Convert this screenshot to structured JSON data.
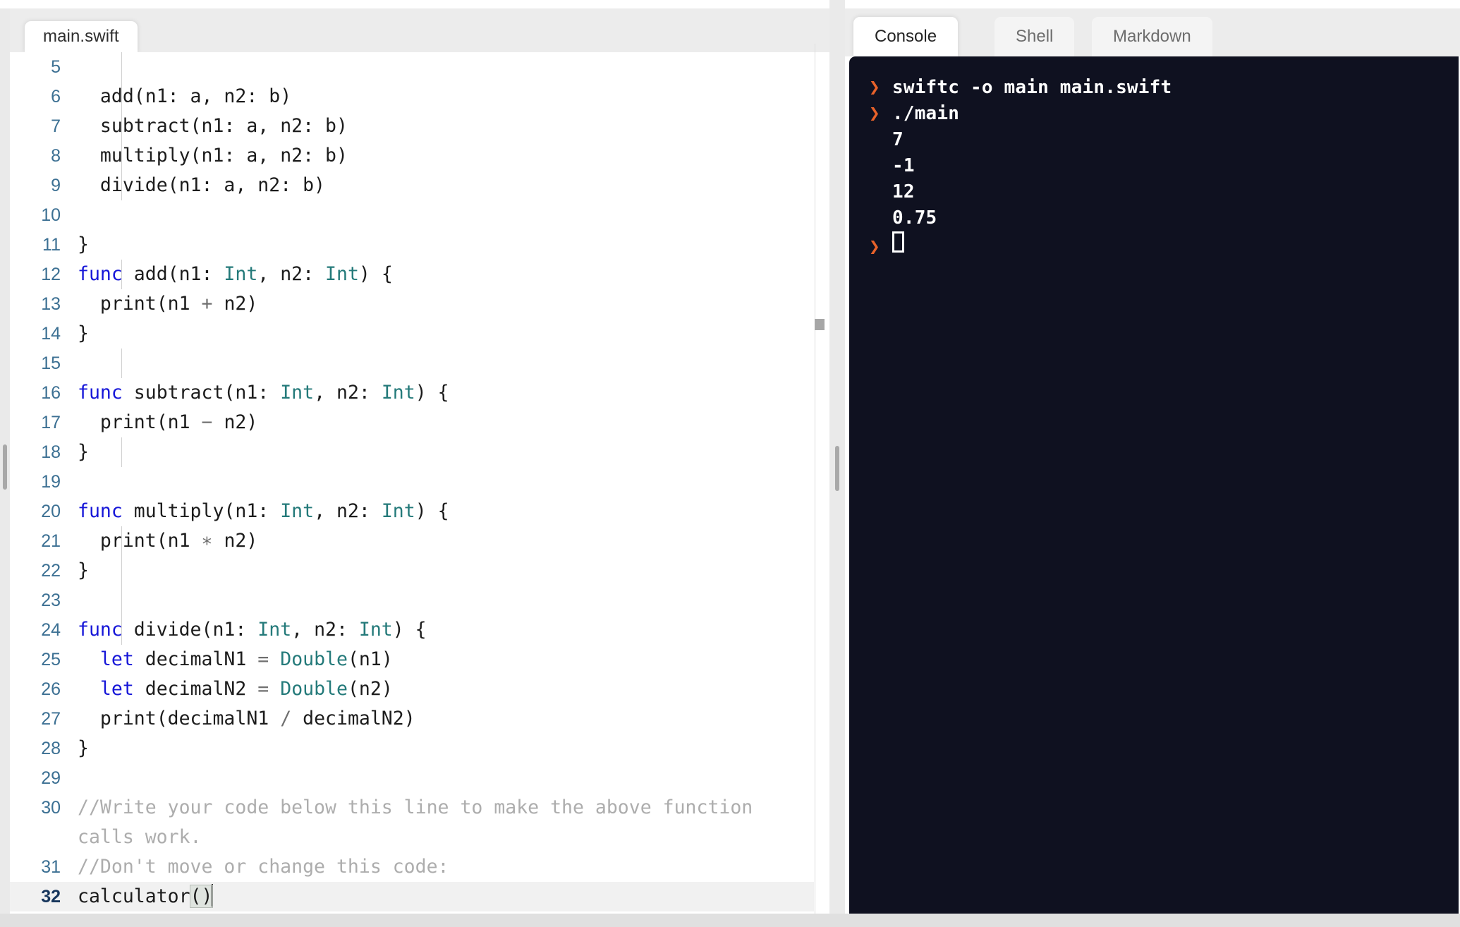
{
  "editor": {
    "tabs": [
      {
        "label": "main.swift",
        "active": true
      }
    ],
    "lines": [
      {
        "num": "5",
        "tokens": []
      },
      {
        "num": "6",
        "tokens": [
          {
            "t": "plain",
            "s": "  add(n1: a, n2: b)"
          }
        ]
      },
      {
        "num": "7",
        "tokens": [
          {
            "t": "plain",
            "s": "  subtract(n1: a, n2: b)"
          }
        ]
      },
      {
        "num": "8",
        "tokens": [
          {
            "t": "plain",
            "s": "  multiply(n1: a, n2: b)"
          }
        ]
      },
      {
        "num": "9",
        "tokens": [
          {
            "t": "plain",
            "s": "  divide(n1: a, n2: b)"
          }
        ]
      },
      {
        "num": "10",
        "tokens": []
      },
      {
        "num": "11",
        "tokens": [
          {
            "t": "plain",
            "s": "}"
          }
        ]
      },
      {
        "num": "12",
        "tokens": [
          {
            "t": "kw",
            "s": "func"
          },
          {
            "t": "plain",
            "s": " add(n1: "
          },
          {
            "t": "type",
            "s": "Int"
          },
          {
            "t": "plain",
            "s": ", n2: "
          },
          {
            "t": "type",
            "s": "Int"
          },
          {
            "t": "plain",
            "s": ") {"
          }
        ]
      },
      {
        "num": "13",
        "tokens": [
          {
            "t": "plain",
            "s": "  print(n1 "
          },
          {
            "t": "op",
            "s": "+"
          },
          {
            "t": "plain",
            "s": " n2)"
          }
        ]
      },
      {
        "num": "14",
        "tokens": [
          {
            "t": "plain",
            "s": "}"
          }
        ]
      },
      {
        "num": "15",
        "tokens": []
      },
      {
        "num": "16",
        "tokens": [
          {
            "t": "kw",
            "s": "func"
          },
          {
            "t": "plain",
            "s": " subtract(n1: "
          },
          {
            "t": "type",
            "s": "Int"
          },
          {
            "t": "plain",
            "s": ", n2: "
          },
          {
            "t": "type",
            "s": "Int"
          },
          {
            "t": "plain",
            "s": ") {"
          }
        ]
      },
      {
        "num": "17",
        "tokens": [
          {
            "t": "plain",
            "s": "  print(n1 "
          },
          {
            "t": "op",
            "s": "−"
          },
          {
            "t": "plain",
            "s": " n2)"
          }
        ]
      },
      {
        "num": "18",
        "tokens": [
          {
            "t": "plain",
            "s": "}"
          }
        ]
      },
      {
        "num": "19",
        "tokens": []
      },
      {
        "num": "20",
        "tokens": [
          {
            "t": "kw",
            "s": "func"
          },
          {
            "t": "plain",
            "s": " multiply(n1: "
          },
          {
            "t": "type",
            "s": "Int"
          },
          {
            "t": "plain",
            "s": ", n2: "
          },
          {
            "t": "type",
            "s": "Int"
          },
          {
            "t": "plain",
            "s": ") {"
          }
        ]
      },
      {
        "num": "21",
        "tokens": [
          {
            "t": "plain",
            "s": "  print(n1 "
          },
          {
            "t": "op",
            "s": "∗"
          },
          {
            "t": "plain",
            "s": " n2)"
          }
        ]
      },
      {
        "num": "22",
        "tokens": [
          {
            "t": "plain",
            "s": "}"
          }
        ]
      },
      {
        "num": "23",
        "tokens": []
      },
      {
        "num": "24",
        "tokens": [
          {
            "t": "kw",
            "s": "func"
          },
          {
            "t": "plain",
            "s": " divide(n1: "
          },
          {
            "t": "type",
            "s": "Int"
          },
          {
            "t": "plain",
            "s": ", n2: "
          },
          {
            "t": "type",
            "s": "Int"
          },
          {
            "t": "plain",
            "s": ") {"
          }
        ]
      },
      {
        "num": "25",
        "tokens": [
          {
            "t": "plain",
            "s": "  "
          },
          {
            "t": "kw",
            "s": "let"
          },
          {
            "t": "plain",
            "s": " decimalN1 "
          },
          {
            "t": "op",
            "s": "="
          },
          {
            "t": "plain",
            "s": " "
          },
          {
            "t": "type",
            "s": "Double"
          },
          {
            "t": "plain",
            "s": "(n1)"
          }
        ]
      },
      {
        "num": "26",
        "tokens": [
          {
            "t": "plain",
            "s": "  "
          },
          {
            "t": "kw",
            "s": "let"
          },
          {
            "t": "plain",
            "s": " decimalN2 "
          },
          {
            "t": "op",
            "s": "="
          },
          {
            "t": "plain",
            "s": " "
          },
          {
            "t": "type",
            "s": "Double"
          },
          {
            "t": "plain",
            "s": "(n2)"
          }
        ]
      },
      {
        "num": "27",
        "tokens": [
          {
            "t": "plain",
            "s": "  print(decimalN1 "
          },
          {
            "t": "op",
            "s": "/"
          },
          {
            "t": "plain",
            "s": " decimalN2)"
          }
        ]
      },
      {
        "num": "28",
        "tokens": [
          {
            "t": "plain",
            "s": "}"
          }
        ]
      },
      {
        "num": "29",
        "tokens": []
      },
      {
        "num": "30",
        "tokens": [
          {
            "t": "cmt",
            "s": "//Write your code below this line to make the above function calls work."
          }
        ]
      },
      {
        "num": "31",
        "tokens": [
          {
            "t": "cmt",
            "s": "//Don't move or change this code:"
          }
        ]
      },
      {
        "num": "32",
        "active": true,
        "tokens": [
          {
            "t": "plain",
            "s": "calculator"
          },
          {
            "t": "bracket",
            "s": "()"
          },
          {
            "t": "caret",
            "s": ""
          }
        ]
      }
    ]
  },
  "console": {
    "tabs": [
      {
        "label": "Console",
        "active": true
      },
      {
        "label": "Shell",
        "active": false
      },
      {
        "label": "Markdown",
        "active": false
      }
    ],
    "prompt_glyph": "❯",
    "lines": [
      {
        "kind": "prompt",
        "text": "swiftc -o main main.swift"
      },
      {
        "kind": "prompt",
        "text": "./main"
      },
      {
        "kind": "output",
        "text": "7"
      },
      {
        "kind": "output",
        "text": "-1"
      },
      {
        "kind": "output",
        "text": "12"
      },
      {
        "kind": "output",
        "text": "0.75"
      },
      {
        "kind": "cursor",
        "text": ""
      }
    ]
  },
  "colors": {
    "console_bg": "#0f1120",
    "prompt_orange": "#e8622a",
    "keyword_blue": "#1616d8",
    "type_teal": "#247a7a",
    "linenum_blue": "#3c7093",
    "comment_gray": "#adadad",
    "tabbar_gray": "#ececec"
  }
}
